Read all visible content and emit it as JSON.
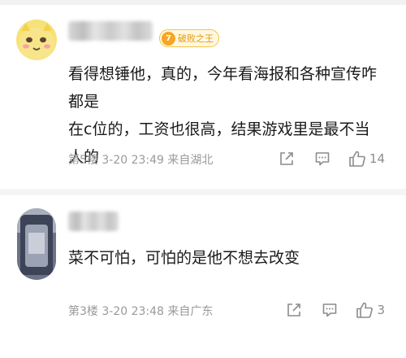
{
  "comments": [
    {
      "badge": {
        "medal": "7",
        "text": "破败之王"
      },
      "text_lines": [
        "看得想锤他，真的，今年看海报和各种宣传咋都是",
        "在c位的，工资也很高，结果游戏里是最不当人的"
      ],
      "meta": "第5楼 3-20 23:49 来自湖北",
      "likes": "14",
      "icons": {
        "share": "share-icon",
        "reply": "reply-icon",
        "like": "thumbs-up-icon"
      }
    },
    {
      "text_lines": [
        "菜不可怕，可怕的是他不想去改变"
      ],
      "meta": "第3楼 3-20 23:48 来自广东",
      "likes": "3",
      "icons": {
        "share": "share-icon",
        "reply": "reply-icon",
        "like": "thumbs-up-icon"
      }
    }
  ],
  "colors": {
    "text": "#1a1a1a",
    "meta": "#9a9a9a",
    "icon": "#8c8c8c",
    "badge_border": "#f3c34a",
    "badge_text": "#e69a10",
    "divider": "#f5f5f5"
  }
}
